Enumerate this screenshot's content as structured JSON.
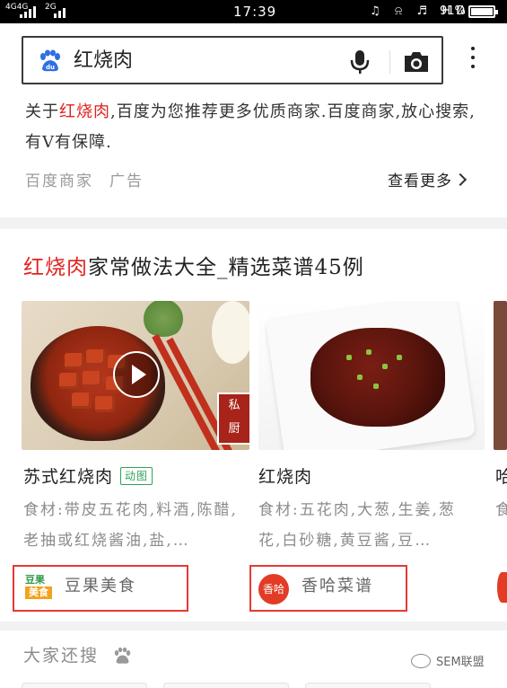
{
  "status_bar": {
    "network_1": "4G",
    "network_2": "4G",
    "network_3": "2G",
    "time": "17:39",
    "icons_text": "♫ ⍾ ♬",
    "hd": "HD",
    "battery_text": "91%",
    "battery_level": 0.91
  },
  "search": {
    "query": "红烧肉",
    "logo_icon": "baidu-paw-logo",
    "voice_icon": "microphone-icon",
    "camera_icon": "camera-icon",
    "more_icon": "more-vertical-icon"
  },
  "ad": {
    "pre": "关于",
    "highlight": "红烧肉",
    "post": ",百度为您推荐更多优质商家.百度商家,放心搜索,有V有保障.",
    "source": "百度商家",
    "tag": "广告",
    "see_more": "查看更多"
  },
  "recipes": {
    "title_highlight": "红烧肉",
    "title_rest": "家常做法大全_精选菜谱45例",
    "items": [
      {
        "name": "苏式红烧肉",
        "badge": "动图",
        "desc": "食材:带皮五花肉,料酒,陈醋,老抽或红烧酱油,盐,…",
        "stamp_top": "私",
        "stamp_bottom": "厨",
        "source_logo_top": "豆果",
        "source_logo_bottom": "美食",
        "source_name": "豆果美食"
      },
      {
        "name": "红烧肉",
        "desc": "食材:五花肉,大葱,生姜,葱花,白砂糖,黄豆酱,豆…",
        "source_logo": "香哈",
        "source_name": "香哈菜谱"
      },
      {
        "name": "哈",
        "desc": "食"
      }
    ]
  },
  "also_search": {
    "title": "大家还搜"
  },
  "watermark": {
    "text": "SEM联盟"
  },
  "colors": {
    "highlight": "#e0221f",
    "badge_green": "#2fa35a",
    "box_red": "#e53a35",
    "baidu_blue": "#2f6fe4"
  }
}
